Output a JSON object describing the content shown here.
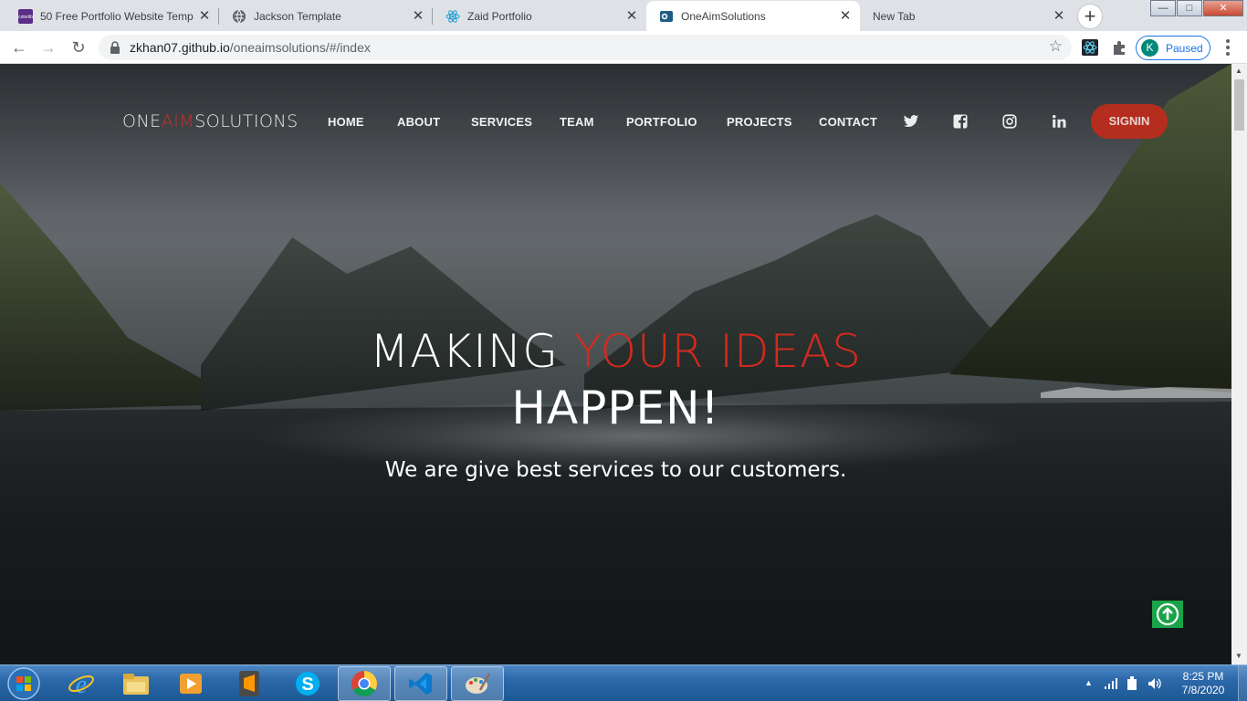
{
  "browser": {
    "tabs": [
      {
        "title": "50 Free Portfolio Website Temp",
        "favicon": "colorlib-icon",
        "active": false
      },
      {
        "title": "Jackson Template",
        "favicon": "globe-icon",
        "active": false
      },
      {
        "title": "Zaid Portfolio",
        "favicon": "react-icon",
        "active": false
      },
      {
        "title": "OneAimSolutions",
        "favicon": "oneaim-icon",
        "active": true
      },
      {
        "title": "New Tab",
        "favicon": "",
        "active": false
      }
    ],
    "favicon_text_colorlib": "colorlib",
    "new_tab_label": "+",
    "address": {
      "host": "zkhan07.github.io",
      "path": "/oneaimsolutions/#/index"
    },
    "profile": {
      "initial": "K",
      "label": "Paused"
    },
    "window_buttons": {
      "minimize": "—",
      "maximize": "□",
      "close": "✕"
    }
  },
  "site": {
    "brand": {
      "part1": "ONE",
      "part2": "AIM",
      "part3": "SOLUTIONS"
    },
    "nav": [
      "HOME",
      "ABOUT",
      "SERVICES",
      "TEAM",
      "PORTFOLIO",
      "PROJECTS",
      "CONTACT"
    ],
    "social_icons": [
      "twitter-icon",
      "facebook-icon",
      "instagram-icon",
      "linkedin-icon"
    ],
    "signin_label": "SIGNIN",
    "hero": {
      "line1_white": "MAKING ",
      "line1_red": "YOUR IDEAS",
      "line2": "HAPPEN!",
      "subtitle": "We are give best services to our customers."
    },
    "colors": {
      "accent": "#d42a1e",
      "signin_bg": "#b52d1f",
      "scroll_top_bg": "#1aa34a"
    }
  },
  "taskbar": {
    "apps": [
      "internet-explorer-icon",
      "file-explorer-icon",
      "media-player-icon",
      "sublime-text-icon",
      "skype-icon",
      "chrome-icon",
      "vscode-icon",
      "paint-icon"
    ],
    "active_app": "chrome-icon",
    "time": "8:25 PM",
    "date": "7/8/2020"
  }
}
